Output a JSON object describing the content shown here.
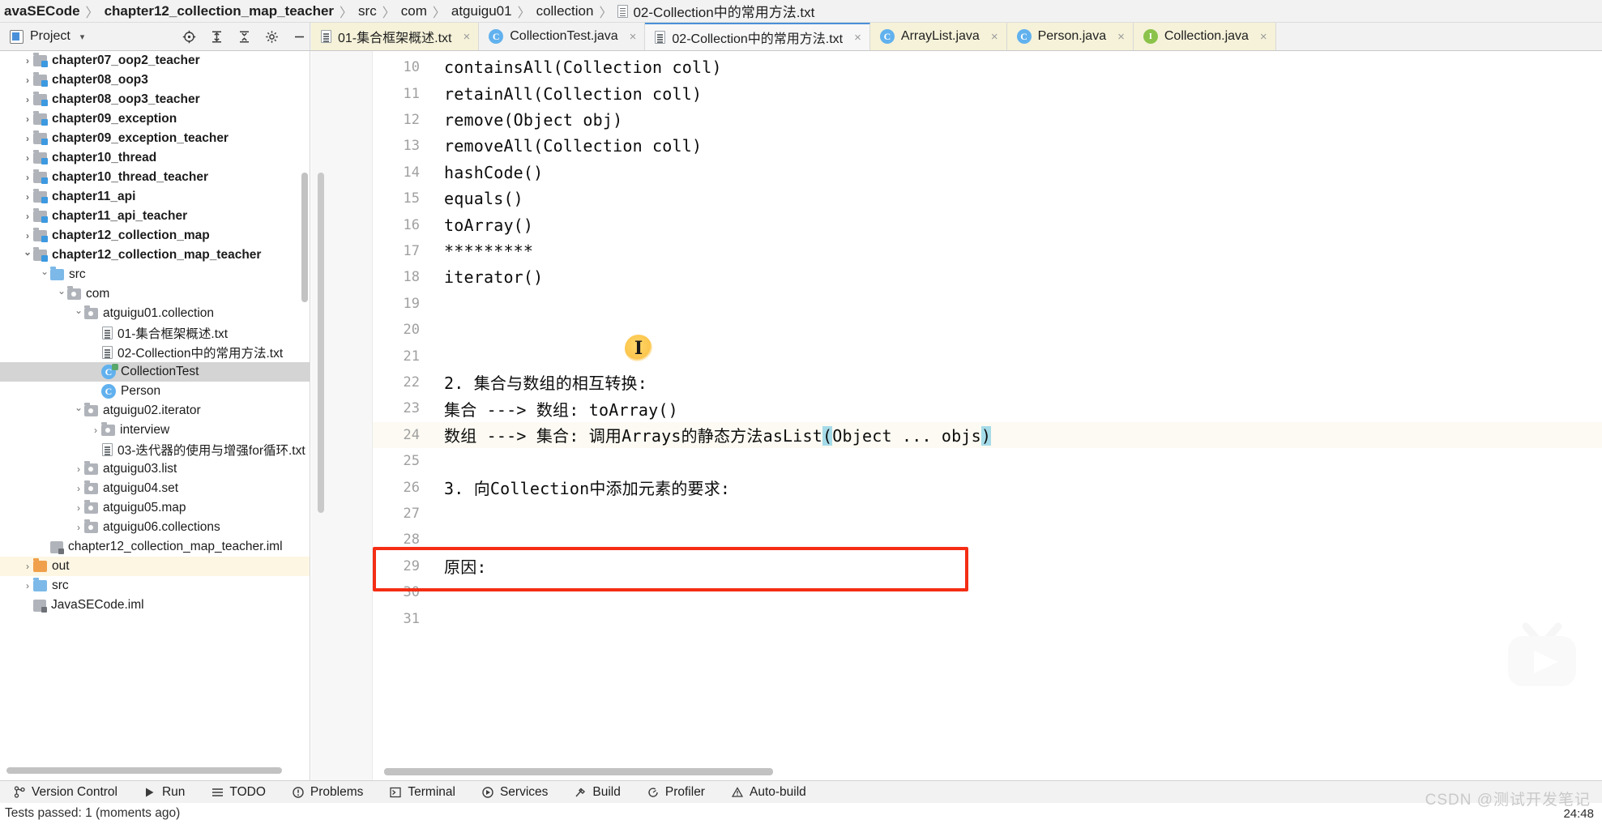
{
  "breadcrumb": {
    "items": [
      {
        "label": "avaSECode",
        "bold": true,
        "icon": null
      },
      {
        "label": "chapter12_collection_map_teacher",
        "bold": true,
        "icon": null
      },
      {
        "label": "src",
        "bold": false,
        "icon": null
      },
      {
        "label": "com",
        "bold": false,
        "icon": null
      },
      {
        "label": "atguigu01",
        "bold": false,
        "icon": null
      },
      {
        "label": "collection",
        "bold": false,
        "icon": null
      },
      {
        "label": "02-Collection中的常用方法.txt",
        "bold": false,
        "icon": "txt-file-icon"
      }
    ],
    "separator": "〉"
  },
  "tool_window": {
    "title": "Project",
    "caret": "▾",
    "buttons": [
      {
        "name": "locate-icon",
        "tooltip": "Select Opened File"
      },
      {
        "name": "expand-all-icon",
        "tooltip": "Expand All"
      },
      {
        "name": "collapse-all-icon",
        "tooltip": "Collapse All"
      },
      {
        "name": "gear-icon",
        "tooltip": "Settings"
      },
      {
        "name": "hide-icon",
        "tooltip": "Hide"
      }
    ]
  },
  "tabs": [
    {
      "label": "01-集合框架概述.txt",
      "icon": "txt-file-icon",
      "active": false,
      "close": "×"
    },
    {
      "label": "CollectionTest.java",
      "icon": "java-class-icon",
      "active": false,
      "close": "×"
    },
    {
      "label": "02-Collection中的常用方法.txt",
      "icon": "txt-file-icon",
      "active": true,
      "close": "×"
    },
    {
      "label": "ArrayList.java",
      "icon": "java-class-icon",
      "active": false,
      "close": "×"
    },
    {
      "label": "Person.java",
      "icon": "java-class-icon",
      "active": false,
      "close": "×"
    },
    {
      "label": "Collection.java",
      "icon": "java-interface-icon",
      "active": false,
      "close": "×"
    }
  ],
  "tree": [
    {
      "label": "chapter07_oop2_teacher",
      "indent": 1,
      "arrow": "closed",
      "icon": "module-folder-icon",
      "bold": true,
      "state": "normal"
    },
    {
      "label": "chapter08_oop3",
      "indent": 1,
      "arrow": "closed",
      "icon": "module-folder-icon",
      "bold": true,
      "state": "normal"
    },
    {
      "label": "chapter08_oop3_teacher",
      "indent": 1,
      "arrow": "closed",
      "icon": "module-folder-icon",
      "bold": true,
      "state": "normal"
    },
    {
      "label": "chapter09_exception",
      "indent": 1,
      "arrow": "closed",
      "icon": "module-folder-icon",
      "bold": true,
      "state": "normal"
    },
    {
      "label": "chapter09_exception_teacher",
      "indent": 1,
      "arrow": "closed",
      "icon": "module-folder-icon",
      "bold": true,
      "state": "normal"
    },
    {
      "label": "chapter10_thread",
      "indent": 1,
      "arrow": "closed",
      "icon": "module-folder-icon",
      "bold": true,
      "state": "normal"
    },
    {
      "label": "chapter10_thread_teacher",
      "indent": 1,
      "arrow": "closed",
      "icon": "module-folder-icon",
      "bold": true,
      "state": "normal"
    },
    {
      "label": "chapter11_api",
      "indent": 1,
      "arrow": "closed",
      "icon": "module-folder-icon",
      "bold": true,
      "state": "normal"
    },
    {
      "label": "chapter11_api_teacher",
      "indent": 1,
      "arrow": "closed",
      "icon": "module-folder-icon",
      "bold": true,
      "state": "normal"
    },
    {
      "label": "chapter12_collection_map",
      "indent": 1,
      "arrow": "closed",
      "icon": "module-folder-icon",
      "bold": true,
      "state": "normal"
    },
    {
      "label": "chapter12_collection_map_teacher",
      "indent": 1,
      "arrow": "open",
      "icon": "module-folder-icon",
      "bold": true,
      "state": "normal"
    },
    {
      "label": "src",
      "indent": 2,
      "arrow": "open",
      "icon": "source-folder-icon",
      "bold": false,
      "state": "normal"
    },
    {
      "label": "com",
      "indent": 3,
      "arrow": "open",
      "icon": "package-folder-icon",
      "bold": false,
      "state": "normal"
    },
    {
      "label": "atguigu01.collection",
      "indent": 4,
      "arrow": "open",
      "icon": "package-folder-icon",
      "bold": false,
      "state": "normal"
    },
    {
      "label": "01-集合框架概述.txt",
      "indent": 5,
      "arrow": "none",
      "icon": "txt-file-icon",
      "bold": false,
      "state": "normal"
    },
    {
      "label": "02-Collection中的常用方法.txt",
      "indent": 5,
      "arrow": "none",
      "icon": "txt-file-icon",
      "bold": false,
      "state": "normal"
    },
    {
      "label": "CollectionTest",
      "indent": 5,
      "arrow": "none",
      "icon": "java-runnable-class-icon",
      "bold": false,
      "state": "selected"
    },
    {
      "label": "Person",
      "indent": 5,
      "arrow": "none",
      "icon": "java-class-icon",
      "bold": false,
      "state": "normal"
    },
    {
      "label": "atguigu02.iterator",
      "indent": 4,
      "arrow": "open",
      "icon": "package-folder-icon",
      "bold": false,
      "state": "normal"
    },
    {
      "label": "interview",
      "indent": 5,
      "arrow": "closed",
      "icon": "package-folder-icon",
      "bold": false,
      "state": "normal"
    },
    {
      "label": "03-迭代器的使用与增强for循环.txt",
      "indent": 5,
      "arrow": "none",
      "icon": "txt-file-icon",
      "bold": false,
      "state": "normal"
    },
    {
      "label": "atguigu03.list",
      "indent": 4,
      "arrow": "closed",
      "icon": "package-folder-icon",
      "bold": false,
      "state": "normal"
    },
    {
      "label": "atguigu04.set",
      "indent": 4,
      "arrow": "closed",
      "icon": "package-folder-icon",
      "bold": false,
      "state": "normal"
    },
    {
      "label": "atguigu05.map",
      "indent": 4,
      "arrow": "closed",
      "icon": "package-folder-icon",
      "bold": false,
      "state": "normal"
    },
    {
      "label": "atguigu06.collections",
      "indent": 4,
      "arrow": "closed",
      "icon": "package-folder-icon",
      "bold": false,
      "state": "normal"
    },
    {
      "label": "chapter12_collection_map_teacher.iml",
      "indent": 2,
      "arrow": "none",
      "icon": "iml-file-icon",
      "bold": false,
      "state": "normal"
    },
    {
      "label": "out",
      "indent": 1,
      "arrow": "closed",
      "icon": "out-folder-icon",
      "bold": false,
      "state": "highlight"
    },
    {
      "label": "src",
      "indent": 1,
      "arrow": "closed",
      "icon": "source-folder-icon",
      "bold": false,
      "state": "normal"
    },
    {
      "label": "JavaSECode.iml",
      "indent": 1,
      "arrow": "none",
      "icon": "iml-file-icon",
      "bold": false,
      "state": "normal"
    }
  ],
  "editor": {
    "lines": [
      {
        "num": "10",
        "text": "containsAll(Collection coll)",
        "caret": false
      },
      {
        "num": "11",
        "text": "retainAll(Collection coll)",
        "caret": false
      },
      {
        "num": "12",
        "text": "remove(Object obj)",
        "caret": false
      },
      {
        "num": "13",
        "text": "removeAll(Collection coll)",
        "caret": false
      },
      {
        "num": "14",
        "text": "hashCode()",
        "caret": false
      },
      {
        "num": "15",
        "text": "equals()",
        "caret": false
      },
      {
        "num": "16",
        "text": "toArray()",
        "caret": false
      },
      {
        "num": "17",
        "text": "*********",
        "caret": false
      },
      {
        "num": "18",
        "text": "iterator()",
        "caret": false
      },
      {
        "num": "19",
        "text": "",
        "caret": false
      },
      {
        "num": "20",
        "text": "",
        "caret": false
      },
      {
        "num": "21",
        "text": "",
        "caret": false
      },
      {
        "num": "22",
        "text": "2. 集合与数组的相互转换:",
        "caret": false
      },
      {
        "num": "23",
        "text": "集合 ---> 数组: toArray()",
        "caret": false
      },
      {
        "num": "24",
        "text": "",
        "caret": true,
        "segments": [
          {
            "t": "数组 ---> 集合: 调用Arrays的静态方法asList",
            "hl": false
          },
          {
            "t": "(",
            "hl": true
          },
          {
            "t": "Object ... objs",
            "hl": false
          },
          {
            "t": ")",
            "hl": true
          }
        ]
      },
      {
        "num": "25",
        "text": "",
        "caret": false
      },
      {
        "num": "26",
        "text": "3. 向Collection中添加元素的要求:",
        "caret": false
      },
      {
        "num": "27",
        "text": "",
        "caret": false
      },
      {
        "num": "28",
        "text": "",
        "caret": false
      },
      {
        "num": "29",
        "text": "原因:",
        "caret": false
      },
      {
        "num": "30",
        "text": "",
        "caret": false
      },
      {
        "num": "31",
        "text": "",
        "caret": false
      }
    ],
    "annotation": {
      "name": "red-highlight-box",
      "color": "#f42d14",
      "target_line": "24"
    },
    "brace_highlight_color": "#a5dbe8",
    "caret_line_color": "#fcfaf2"
  },
  "statusbar": {
    "items": [
      {
        "label": "Version Control",
        "icon": "branch-icon"
      },
      {
        "label": "Run",
        "icon": "play-icon"
      },
      {
        "label": "TODO",
        "icon": "list-icon"
      },
      {
        "label": "Problems",
        "icon": "error-circle-icon"
      },
      {
        "label": "Terminal",
        "icon": "terminal-icon"
      },
      {
        "label": "Services",
        "icon": "services-icon"
      },
      {
        "label": "Build",
        "icon": "hammer-icon"
      },
      {
        "label": "Profiler",
        "icon": "profiler-icon"
      },
      {
        "label": "Auto-build",
        "icon": "warning-triangle-icon"
      }
    ]
  },
  "footer": {
    "tests_status": "Tests passed: 1 (moments ago)",
    "clock": "24:48",
    "watermark": "CSDN @测试开发笔记"
  }
}
